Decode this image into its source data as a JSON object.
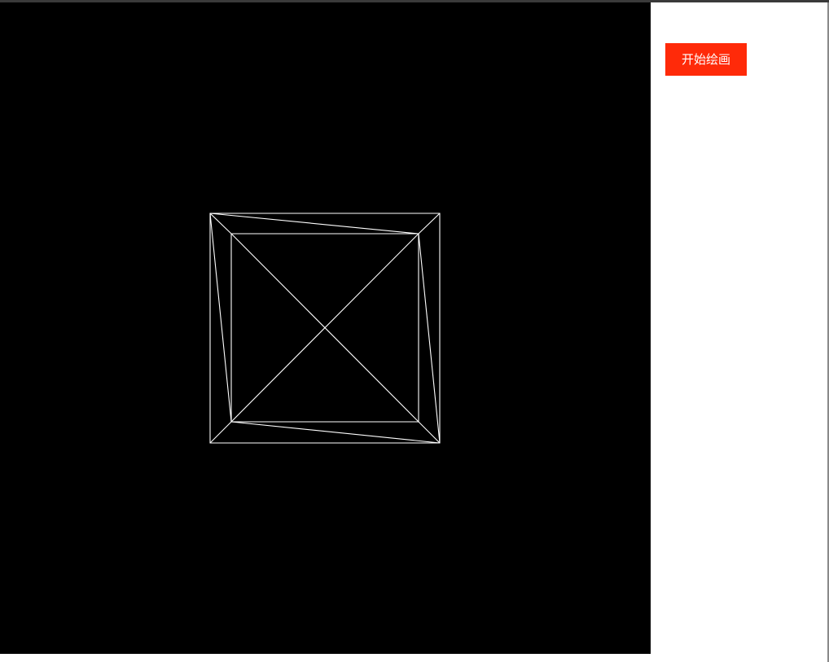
{
  "canvas": {
    "background_color": "#000000",
    "stroke_color": "#ffffff"
  },
  "panel": {
    "start_button_label": "开始绘画",
    "start_button_color": "#ff2a09"
  }
}
